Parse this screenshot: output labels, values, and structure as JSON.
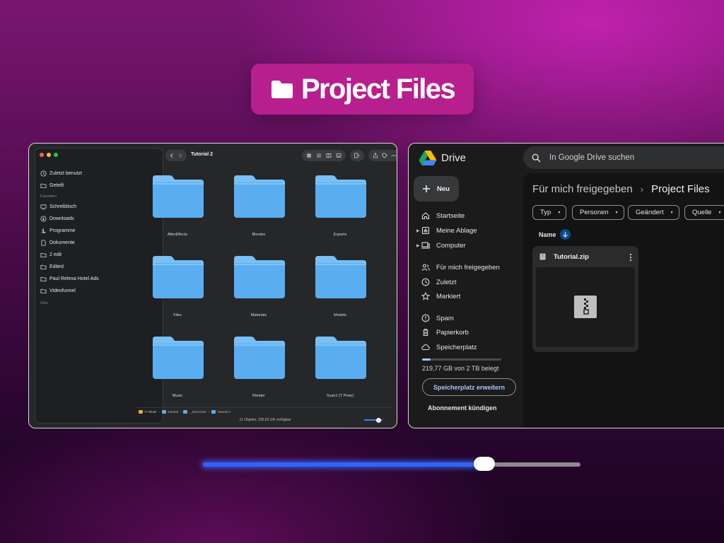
{
  "title": {
    "text": "Project Files",
    "icon": "folder-icon"
  },
  "finder": {
    "window_title": "Tutorial 2",
    "sidebar": {
      "top_items": [
        {
          "label": "Zuletzt benutzt",
          "icon": "clock-icon"
        },
        {
          "label": "Geteilt",
          "icon": "shared-folder-icon"
        }
      ],
      "favorites_header": "Favoriten",
      "favorites": [
        {
          "label": "Schreibtisch",
          "icon": "desktop-icon"
        },
        {
          "label": "Downloads",
          "icon": "download-icon"
        },
        {
          "label": "Programme",
          "icon": "apps-icon"
        },
        {
          "label": "Dokumente",
          "icon": "document-icon"
        },
        {
          "label": "2 edit",
          "icon": "folder-icon"
        },
        {
          "label": "Edited",
          "icon": "folder-icon"
        },
        {
          "label": "Paul Relexa Hotel Ads",
          "icon": "folder-icon"
        },
        {
          "label": "Videofunnel",
          "icon": "folder-icon"
        }
      ],
      "places_header": "Orte"
    },
    "folders": [
      "AfterEffects",
      "Blender",
      "Exports",
      "Files",
      "Materials",
      "Models",
      "Music",
      "Render",
      "Scan1 (T Pose)"
    ],
    "pathbar": [
      "77 Bilabl",
      "Tutorial",
      "__MACOSX",
      "Tutorial 2"
    ],
    "status": "11 Objekte, 335,83 GB verfügbar",
    "zoom_fraction": 0.8,
    "colors": {
      "folder": "#5aaef0",
      "folder_tab": "#78c0f5"
    }
  },
  "drive": {
    "logo_text": "Drive",
    "search_placeholder": "In Google Drive suchen",
    "new_button": "Neu",
    "nav_group1": [
      {
        "label": "Startseite",
        "icon": "home-icon",
        "expandable": false
      },
      {
        "label": "Meine Ablage",
        "icon": "my-drive-icon",
        "expandable": true
      },
      {
        "label": "Computer",
        "icon": "computer-icon",
        "expandable": true
      }
    ],
    "nav_group2": [
      {
        "label": "Für mich freigegeben",
        "icon": "shared-people-icon"
      },
      {
        "label": "Zuletzt",
        "icon": "clock-icon"
      },
      {
        "label": "Markiert",
        "icon": "star-icon"
      }
    ],
    "nav_group3": [
      {
        "label": "Spam",
        "icon": "spam-icon"
      },
      {
        "label": "Papierkorb",
        "icon": "trash-icon"
      },
      {
        "label": "Speicherplatz",
        "icon": "cloud-icon"
      }
    ],
    "storage_text": "219,77 GB von 2 TB belegt",
    "storage_used_fraction": 0.107,
    "storage_button": "Speicherplatz erweitern",
    "cancel_subscription": "Abonnement kündigen",
    "breadcrumb": [
      "Für mich freigegeben",
      "Project Files"
    ],
    "filters": [
      "Typ",
      "Personen",
      "Geändert",
      "Quelle"
    ],
    "sort_label": "Name",
    "file": {
      "name": "Tutorial.zip",
      "icon": "zip-icon"
    },
    "colors": {
      "accent": "#a8c7fa",
      "sort_badge": "#0b4a8a"
    }
  },
  "slider": {
    "value_fraction": 0.745,
    "fill_color": "#2d63ff"
  }
}
